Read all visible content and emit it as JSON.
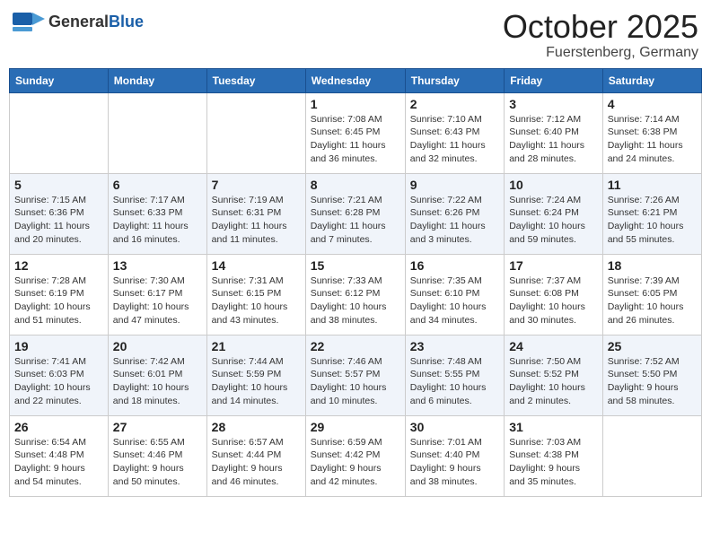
{
  "header": {
    "logo_general": "General",
    "logo_blue": "Blue",
    "month": "October 2025",
    "location": "Fuerstenberg, Germany"
  },
  "calendar": {
    "columns": [
      "Sunday",
      "Monday",
      "Tuesday",
      "Wednesday",
      "Thursday",
      "Friday",
      "Saturday"
    ],
    "rows": [
      [
        {
          "day": "",
          "info": ""
        },
        {
          "day": "",
          "info": ""
        },
        {
          "day": "",
          "info": ""
        },
        {
          "day": "1",
          "info": "Sunrise: 7:08 AM\nSunset: 6:45 PM\nDaylight: 11 hours\nand 36 minutes."
        },
        {
          "day": "2",
          "info": "Sunrise: 7:10 AM\nSunset: 6:43 PM\nDaylight: 11 hours\nand 32 minutes."
        },
        {
          "day": "3",
          "info": "Sunrise: 7:12 AM\nSunset: 6:40 PM\nDaylight: 11 hours\nand 28 minutes."
        },
        {
          "day": "4",
          "info": "Sunrise: 7:14 AM\nSunset: 6:38 PM\nDaylight: 11 hours\nand 24 minutes."
        }
      ],
      [
        {
          "day": "5",
          "info": "Sunrise: 7:15 AM\nSunset: 6:36 PM\nDaylight: 11 hours\nand 20 minutes."
        },
        {
          "day": "6",
          "info": "Sunrise: 7:17 AM\nSunset: 6:33 PM\nDaylight: 11 hours\nand 16 minutes."
        },
        {
          "day": "7",
          "info": "Sunrise: 7:19 AM\nSunset: 6:31 PM\nDaylight: 11 hours\nand 11 minutes."
        },
        {
          "day": "8",
          "info": "Sunrise: 7:21 AM\nSunset: 6:28 PM\nDaylight: 11 hours\nand 7 minutes."
        },
        {
          "day": "9",
          "info": "Sunrise: 7:22 AM\nSunset: 6:26 PM\nDaylight: 11 hours\nand 3 minutes."
        },
        {
          "day": "10",
          "info": "Sunrise: 7:24 AM\nSunset: 6:24 PM\nDaylight: 10 hours\nand 59 minutes."
        },
        {
          "day": "11",
          "info": "Sunrise: 7:26 AM\nSunset: 6:21 PM\nDaylight: 10 hours\nand 55 minutes."
        }
      ],
      [
        {
          "day": "12",
          "info": "Sunrise: 7:28 AM\nSunset: 6:19 PM\nDaylight: 10 hours\nand 51 minutes."
        },
        {
          "day": "13",
          "info": "Sunrise: 7:30 AM\nSunset: 6:17 PM\nDaylight: 10 hours\nand 47 minutes."
        },
        {
          "day": "14",
          "info": "Sunrise: 7:31 AM\nSunset: 6:15 PM\nDaylight: 10 hours\nand 43 minutes."
        },
        {
          "day": "15",
          "info": "Sunrise: 7:33 AM\nSunset: 6:12 PM\nDaylight: 10 hours\nand 38 minutes."
        },
        {
          "day": "16",
          "info": "Sunrise: 7:35 AM\nSunset: 6:10 PM\nDaylight: 10 hours\nand 34 minutes."
        },
        {
          "day": "17",
          "info": "Sunrise: 7:37 AM\nSunset: 6:08 PM\nDaylight: 10 hours\nand 30 minutes."
        },
        {
          "day": "18",
          "info": "Sunrise: 7:39 AM\nSunset: 6:05 PM\nDaylight: 10 hours\nand 26 minutes."
        }
      ],
      [
        {
          "day": "19",
          "info": "Sunrise: 7:41 AM\nSunset: 6:03 PM\nDaylight: 10 hours\nand 22 minutes."
        },
        {
          "day": "20",
          "info": "Sunrise: 7:42 AM\nSunset: 6:01 PM\nDaylight: 10 hours\nand 18 minutes."
        },
        {
          "day": "21",
          "info": "Sunrise: 7:44 AM\nSunset: 5:59 PM\nDaylight: 10 hours\nand 14 minutes."
        },
        {
          "day": "22",
          "info": "Sunrise: 7:46 AM\nSunset: 5:57 PM\nDaylight: 10 hours\nand 10 minutes."
        },
        {
          "day": "23",
          "info": "Sunrise: 7:48 AM\nSunset: 5:55 PM\nDaylight: 10 hours\nand 6 minutes."
        },
        {
          "day": "24",
          "info": "Sunrise: 7:50 AM\nSunset: 5:52 PM\nDaylight: 10 hours\nand 2 minutes."
        },
        {
          "day": "25",
          "info": "Sunrise: 7:52 AM\nSunset: 5:50 PM\nDaylight: 9 hours\nand 58 minutes."
        }
      ],
      [
        {
          "day": "26",
          "info": "Sunrise: 6:54 AM\nSunset: 4:48 PM\nDaylight: 9 hours\nand 54 minutes."
        },
        {
          "day": "27",
          "info": "Sunrise: 6:55 AM\nSunset: 4:46 PM\nDaylight: 9 hours\nand 50 minutes."
        },
        {
          "day": "28",
          "info": "Sunrise: 6:57 AM\nSunset: 4:44 PM\nDaylight: 9 hours\nand 46 minutes."
        },
        {
          "day": "29",
          "info": "Sunrise: 6:59 AM\nSunset: 4:42 PM\nDaylight: 9 hours\nand 42 minutes."
        },
        {
          "day": "30",
          "info": "Sunrise: 7:01 AM\nSunset: 4:40 PM\nDaylight: 9 hours\nand 38 minutes."
        },
        {
          "day": "31",
          "info": "Sunrise: 7:03 AM\nSunset: 4:38 PM\nDaylight: 9 hours\nand 35 minutes."
        },
        {
          "day": "",
          "info": ""
        }
      ]
    ]
  }
}
